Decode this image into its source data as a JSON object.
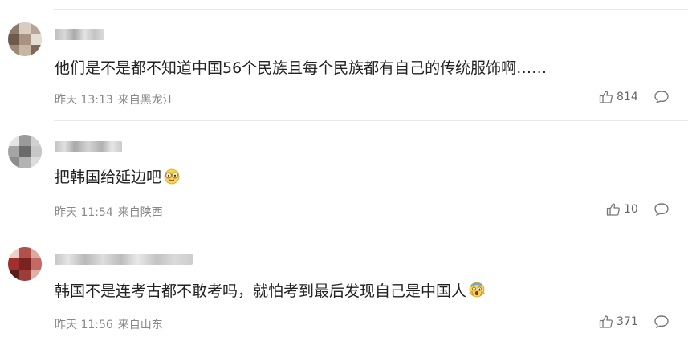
{
  "comments": [
    {
      "content": "他们是不是都不知道中国56个民族且每个民族都有自己的传统服饰啊……",
      "time": "昨天 13:13",
      "location": "来自黑龙江",
      "likes": "814",
      "emoji": "",
      "avatar_colors": [
        "#8c7a6b",
        "#c9b8a8",
        "#6e5a4c"
      ]
    },
    {
      "content": "把韩国给延边吧",
      "time": "昨天 11:54",
      "location": "来自陕西",
      "likes": "10",
      "emoji": "glasses-face-emoji",
      "avatar_colors": [
        "#9a9a9a",
        "#cfcfcf",
        "#6b6b6b"
      ]
    },
    {
      "content": "韩国不是连考古都不敢考吗，就怕考到最后发现自己是中国人",
      "time": "昨天 11:56",
      "location": "来自山东",
      "likes": "371",
      "emoji": "screaming-face-emoji",
      "avatar_colors": [
        "#a0302d",
        "#e0b0a8",
        "#5a1c1a"
      ]
    }
  ],
  "icons": {
    "like": "thumbs-up-icon",
    "reply": "comment-bubble-icon"
  },
  "colors": {
    "text": "#222222",
    "meta": "#888888",
    "divider": "#eaeaea"
  }
}
